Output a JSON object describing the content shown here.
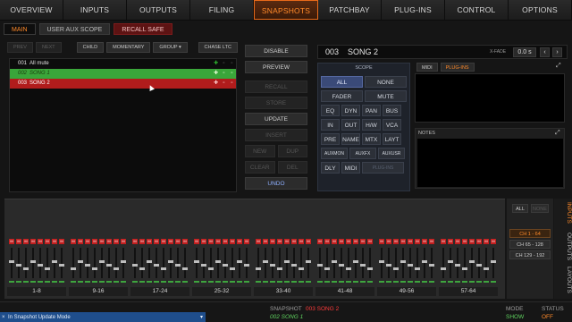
{
  "nav": {
    "tabs": [
      "OVERVIEW",
      "INPUTS",
      "OUTPUTS",
      "FILING",
      "SNAPSHOTS",
      "PATCHBAY",
      "PLUG-INS",
      "CONTROL",
      "OPTIONS"
    ],
    "active_index": 4
  },
  "subtabs": {
    "main": "MAIN",
    "user_aux_scope": "USER AUX SCOPE",
    "recall_safe": "RECALL SAFE"
  },
  "list_buttons": {
    "prev": "PREV",
    "next": "NEXT",
    "child": "CHILD",
    "momentary": "MOMENTARY",
    "group": "GROUP",
    "chase_ltc": "CHASE LTC"
  },
  "snapshots": [
    {
      "num": "001",
      "name": "All mute",
      "state": "normal"
    },
    {
      "num": "002",
      "name": "SONG 1",
      "state": "current"
    },
    {
      "num": "003",
      "name": "SONG 2",
      "state": "selected"
    }
  ],
  "actions": {
    "disable": "DISABLE",
    "preview": "PREVIEW",
    "recall": "RECALL",
    "store": "STORE",
    "update": "UPDATE",
    "insert": "INSERT",
    "new": "NEW",
    "dup": "DUP",
    "clear": "CLEAR",
    "del": "DEL",
    "undo": "UNDO"
  },
  "header": {
    "num": "003",
    "name": "SONG 2",
    "xfade_label": "X-FADE",
    "xfade_value": "0.0 s"
  },
  "scope": {
    "title": "SCOPE",
    "all": "ALL",
    "none": "NONE",
    "fader": "FADER",
    "mute": "MUTE",
    "row1": [
      "EQ",
      "DYN",
      "PAN",
      "BUS"
    ],
    "row2": [
      "IN",
      "OUT",
      "H/W",
      "VCA"
    ],
    "row3": [
      "PRE",
      "NAME",
      "MTX",
      "LAYT"
    ],
    "row4": [
      "AUXMON",
      "AUXFX",
      "AUXUSR"
    ],
    "row5": [
      "DLY",
      "MIDI",
      "PLUG-INS"
    ]
  },
  "midi_tabs": {
    "midi": "MIDI",
    "plugins": "PLUG-INS"
  },
  "notes_label": "NOTES",
  "banks": [
    "1-8",
    "9-16",
    "17-24",
    "25-32",
    "33-40",
    "41-48",
    "49-56",
    "57-64"
  ],
  "mute_letter": "M",
  "strip_side": {
    "all": "ALL",
    "none": "NONE",
    "ranges": [
      "CH 1 - 64",
      "CH 65 - 128",
      "CH 129 - 192"
    ]
  },
  "vtabs": [
    "INPUTS",
    "OUTPUTS",
    "LAYOUTS"
  ],
  "status": {
    "message": "In Snapshot Update Mode",
    "snapshot_label": "SNAPSHOT",
    "snapshot_next": "003 SONG 2",
    "snapshot_current": "002 SONG 1",
    "mode_label": "MODE",
    "mode_value": "SHOW",
    "status_label": "STATUS",
    "status_value": "OFF"
  }
}
